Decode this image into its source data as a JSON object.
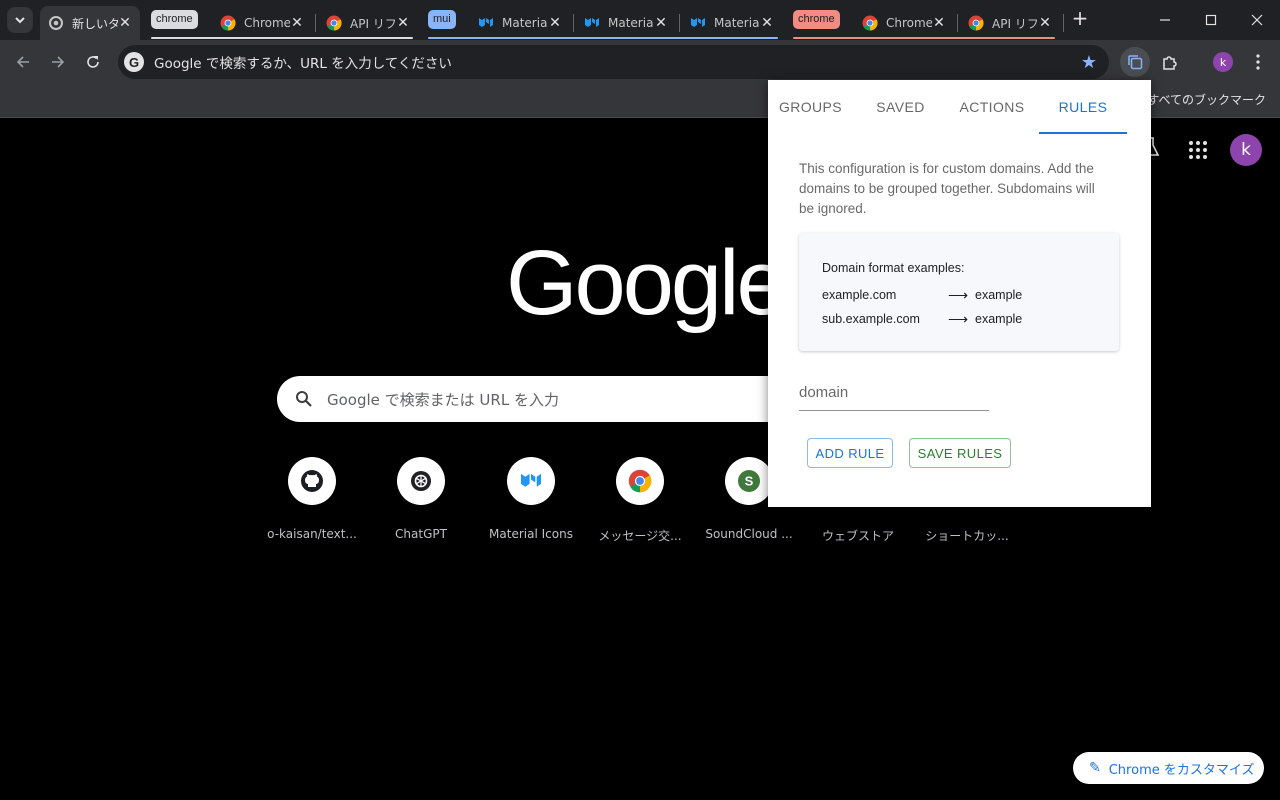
{
  "tabstrip": {
    "active_tab_title": "新しいタブ",
    "tabs": [
      {
        "title": "Chrome"
      },
      {
        "title": "API リファレンス"
      },
      {
        "title": "Material"
      },
      {
        "title": "Material"
      },
      {
        "title": "Material"
      },
      {
        "title": "Chrome"
      },
      {
        "title": "API リファレンス"
      }
    ],
    "groups": [
      {
        "label": "chrome",
        "color": "#dadce0"
      },
      {
        "label": "mui",
        "color": "#8ab4f8"
      },
      {
        "label": "chrome",
        "color": "#f28b82"
      }
    ],
    "new_tab_symbol": "+",
    "close_symbol": "✕"
  },
  "toolbar": {
    "omnibox_text": "Google で検索するか、URL を入力してください"
  },
  "bookmarks": {
    "all_bookmarks_label": "すべてのブックマーク"
  },
  "ntp": {
    "logo_text": "Google",
    "search_placeholder": "Google で検索または URL を入力",
    "avatar_letter": "k",
    "shortcuts": [
      {
        "label": "o-kaisan/text...",
        "icon": "github-icon"
      },
      {
        "label": "ChatGPT",
        "icon": "openai-icon"
      },
      {
        "label": "Material Icons",
        "icon": "mui-icon"
      },
      {
        "label": "メッセージ交...",
        "icon": "chrome-icon"
      },
      {
        "label": "SoundCloud ...",
        "icon": "s-icon"
      },
      {
        "label": "ウェブストア",
        "icon": "webstore-icon"
      },
      {
        "label": "ショートカッ...",
        "icon": "add-icon"
      }
    ],
    "customize_label": "Chrome をカスタマイズ"
  },
  "popup": {
    "tabs": [
      {
        "label": "GROUPS"
      },
      {
        "label": "SAVED"
      },
      {
        "label": "ACTIONS"
      },
      {
        "label": "RULES",
        "selected": true
      }
    ],
    "description": "This configuration is for custom domains. Add the domains to be grouped together. Subdomains will be ignored.",
    "examples_title": "Domain format examples:",
    "examples": [
      {
        "from": "example.com",
        "arrow": "⟶",
        "to": "example"
      },
      {
        "from": "sub.example.com",
        "arrow": "⟶",
        "to": "example"
      }
    ],
    "domain_placeholder": "domain",
    "add_rule_label": "ADD RULE",
    "save_rules_label": "SAVE RULES",
    "accent_color": "#1976d2",
    "save_color": "#2e7d32"
  },
  "profile": {
    "letter": "k",
    "color": "#8e44ad"
  }
}
